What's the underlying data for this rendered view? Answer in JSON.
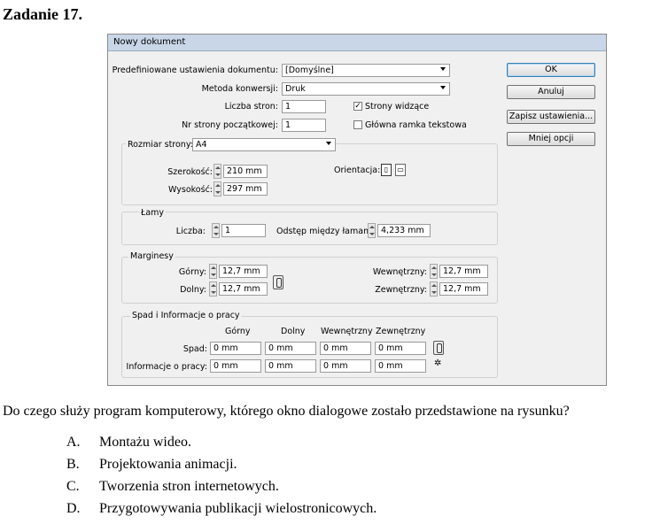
{
  "task_title": "Zadanie 17.",
  "dialog": {
    "title": "Nowy dokument",
    "preset_label": "Predefiniowane ustawienia dokumentu:",
    "preset_value": "[Domyślne]",
    "method_label": "Metoda konwersji:",
    "method_value": "Druk",
    "pages_label": "Liczba stron:",
    "pages_value": "1",
    "facing_label": "Strony widzące",
    "facing_checked": "✓",
    "start_label": "Nr strony początkowej:",
    "start_value": "1",
    "master_label": "Główna ramka tekstowa",
    "size_label": "Rozmiar strony:",
    "size_value": "A4",
    "width_label": "Szerokość:",
    "width_value": "210 mm",
    "height_label": "Wysokość:",
    "height_value": "297 mm",
    "orientation_label": "Orientacja:",
    "columns_title": "Łamy",
    "columns_count_label": "Liczba:",
    "columns_count_value": "1",
    "gutter_label": "Odstęp między łamami:",
    "gutter_value": "4,233 mm",
    "margins_title": "Marginesy",
    "top_label": "Górny:",
    "top_value": "12,7 mm",
    "bottom_label": "Dolny:",
    "bottom_value": "12,7 mm",
    "inside_label": "Wewnętrzny:",
    "inside_value": "12,7 mm",
    "outside_label": "Zewnętrzny:",
    "outside_value": "12,7 mm",
    "bleed_title": "Spad i Informacje o pracy",
    "col_headers": [
      "Górny",
      "Dolny",
      "Wewnętrzny",
      "Zewnętrzny"
    ],
    "bleed_label": "Spad:",
    "bleed_values": [
      "0 mm",
      "0 mm",
      "0 mm",
      "0 mm"
    ],
    "slug_label": "Informacje o pracy:",
    "slug_values": [
      "0 mm",
      "0 mm",
      "0 mm",
      "0 mm"
    ],
    "buttons": {
      "ok": "OK",
      "cancel": "Anuluj",
      "save": "Zapisz ustawienia...",
      "fewer": "Mniej opcji"
    }
  },
  "question": "Do czego służy program komputerowy, którego okno dialogowe zostało przedstawione na rysunku?",
  "answers": [
    {
      "letter": "A.",
      "text": "Montażu wideo."
    },
    {
      "letter": "B.",
      "text": "Projektowania animacji."
    },
    {
      "letter": "C.",
      "text": "Tworzenia stron internetowych."
    },
    {
      "letter": "D.",
      "text": "Przygotowywania publikacji wielostronicowych."
    }
  ]
}
